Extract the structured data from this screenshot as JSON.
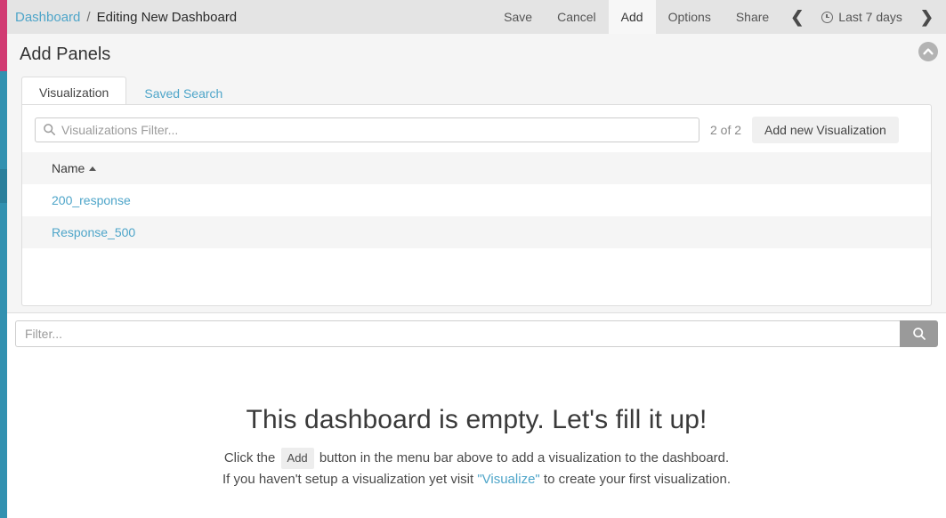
{
  "topnav": {
    "breadcrumb": {
      "root": "Dashboard",
      "separator": "/",
      "current": "Editing New Dashboard"
    },
    "items": [
      {
        "label": "Save",
        "active": false
      },
      {
        "label": "Cancel",
        "active": false
      },
      {
        "label": "Add",
        "active": true
      },
      {
        "label": "Options",
        "active": false
      },
      {
        "label": "Share",
        "active": false
      }
    ],
    "time_prev_icon": "chevron-left-icon",
    "time_next_icon": "chevron-right-icon",
    "time_clock_icon": "clock-icon",
    "time_range": "Last 7 days",
    "background": "#e4e4e4"
  },
  "rails": {
    "pink": "#d13b72",
    "teal": "#3291b0"
  },
  "add_panels": {
    "title": "Add Panels",
    "collapse_icon": "chevron-up-icon",
    "tabs": [
      {
        "label": "Visualization",
        "active": true
      },
      {
        "label": "Saved Search",
        "active": false
      }
    ],
    "filter": {
      "placeholder": "Visualizations Filter...",
      "value": "",
      "icon": "search-icon"
    },
    "count_label": "2 of 2",
    "add_new_button": "Add new Visualization",
    "table": {
      "columns": [
        "Name"
      ],
      "sort_direction": "asc",
      "rows": [
        {
          "name": "200_response"
        },
        {
          "name": "Response_500"
        }
      ]
    }
  },
  "query_bar": {
    "placeholder": "Filter...",
    "value": "",
    "search_icon": "search-icon"
  },
  "empty_state": {
    "heading": "This dashboard is empty. Let's fill it up!",
    "line1_before": "Click the",
    "line1_badge": "Add",
    "line1_after": "button in the menu bar above to add a visualization to the dashboard.",
    "line2_before": "If you haven't setup a visualization yet visit",
    "line2_link": "\"Visualize\"",
    "line2_after": "to create your first visualization."
  }
}
